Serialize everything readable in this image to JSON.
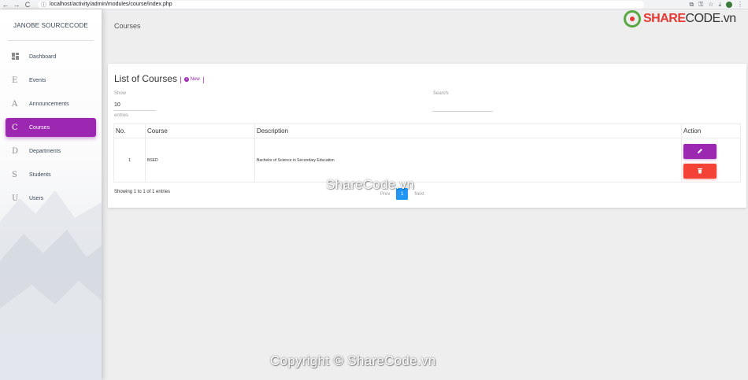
{
  "browser": {
    "url": "localhost/activity/admin/modules/course/index.php",
    "back": "←",
    "forward": "→",
    "reload": "C"
  },
  "sidebar": {
    "brand": "JANOBE SOURCECODE",
    "items": [
      {
        "icon": "dashboard-icon",
        "letter": "",
        "label": "Dashboard"
      },
      {
        "icon": "",
        "letter": "E",
        "label": "Events"
      },
      {
        "icon": "",
        "letter": "A",
        "label": "Announcements"
      },
      {
        "icon": "",
        "letter": "C",
        "label": "Courses"
      },
      {
        "icon": "",
        "letter": "D",
        "label": "Departments"
      },
      {
        "icon": "",
        "letter": "S",
        "label": "Students"
      },
      {
        "icon": "",
        "letter": "U",
        "label": "Users"
      }
    ],
    "active_index": 3
  },
  "header": {
    "title": "Courses"
  },
  "card": {
    "title": "List of Courses",
    "separator": "|",
    "new_label": "New",
    "show_label": "Show",
    "show_value": "10",
    "entries_label": "entries",
    "search_label": "Search:",
    "columns": [
      "No.",
      "Course",
      "Description",
      "Action"
    ],
    "rows": [
      {
        "no": "1",
        "course": "BSED",
        "description": "Bachelor of Science in Secondary Education"
      }
    ],
    "showing": "Showing 1 to 1 of 1 entries",
    "pager": {
      "prev": "Prev",
      "current": "1",
      "next": "Next"
    }
  },
  "watermark": {
    "logo_share": "SHARE",
    "logo_code": "CODE.vn",
    "center": "ShareCode.vn",
    "bottom": "Copyright © ShareCode.vn"
  },
  "colors": {
    "accent": "#9c27b0",
    "danger": "#f44336",
    "pager_active": "#2196f3",
    "background": "#eeeeee"
  }
}
